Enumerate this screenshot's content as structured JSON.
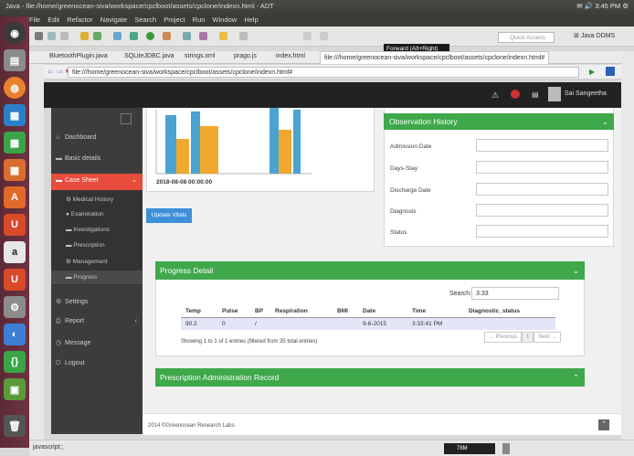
{
  "window": {
    "title": "Java - file:/home/greenocean-siva/workspace/cpclboot/assets/cpclone/indexn.html - ADT",
    "tray_time": "3:45 PM",
    "menu": [
      "File",
      "Edit",
      "Refactor",
      "Navigate",
      "Search",
      "Project",
      "Run",
      "Window",
      "Help"
    ]
  },
  "toolbar": {
    "quick_access_placeholder": "Quick Access",
    "perspective_java": "Java",
    "perspective_ddms": "DDMS",
    "tooltip": "Forward (Alt+Right)"
  },
  "editor_tabs": [
    "BluetoothPlugin.java",
    "SQLiteJDBC.java",
    "strings.xml",
    "prago.js",
    "index.html",
    "file:///home/greenocean-siva/workspace/cpclboot/assets/cpclone/indexn.html#"
  ],
  "browser": {
    "url": "file:///home/greenocean-siva/workspace/cpclboot/assets/cpclone/indexn.html#"
  },
  "header": {
    "user_name": "Sai Sangeetha"
  },
  "sidebar": {
    "items": [
      {
        "icon": "home-icon",
        "label": "Dashboard"
      },
      {
        "icon": "folder-icon",
        "label": "Basic details"
      },
      {
        "icon": "folder-icon",
        "label": "Case Sheet"
      }
    ],
    "subitems": [
      {
        "icon": "cogs-icon",
        "label": "Medical History"
      },
      {
        "icon": "circle-icon",
        "label": "Examination"
      },
      {
        "icon": "folder-icon",
        "label": "Investigations"
      },
      {
        "icon": "folder-icon",
        "label": "Prescription"
      },
      {
        "icon": "cogs-icon",
        "label": "Management"
      },
      {
        "icon": "folder-icon",
        "label": "Progress"
      }
    ],
    "bottom_items": [
      {
        "icon": "gear-icon",
        "label": "Settings"
      },
      {
        "icon": "printer-icon",
        "label": "Report"
      },
      {
        "icon": "clock-icon",
        "label": "Message"
      },
      {
        "icon": "power-icon",
        "label": "Logout"
      }
    ]
  },
  "vitals": {
    "chart_date": "2018-08-08 00:00:00",
    "update_button": "Update Vitals"
  },
  "observation": {
    "title": "Observation History",
    "fields": [
      "Admission Date",
      "Days-Stay",
      "Discharge Date",
      "Diagnosis",
      "Status"
    ]
  },
  "progress": {
    "title": "Progress Detail",
    "search_label": "Search:",
    "search_value": "3:33",
    "columns": [
      "Temp",
      "Pulse",
      "BP",
      "Respiration",
      "BMI",
      "Date",
      "Time",
      "Diagnostic_status"
    ],
    "rows": [
      [
        "90.2",
        "0",
        "/",
        "",
        "",
        "9-6-2015",
        "3:33:41 PM",
        ""
      ]
    ],
    "info": "Showing 1 to 1 of 1 entries (filtered from 35 total entries)",
    "pager": {
      "previous": "← Previous",
      "page": "1",
      "next": "Next →"
    }
  },
  "prescription": {
    "title": "Prescription Administration Record"
  },
  "footer": {
    "text": "2014 ©Greenocean Research Labs."
  },
  "status_bar": {
    "left": "javascript:;",
    "memory": "78M"
  },
  "colors": {
    "green": "#3ea84b",
    "active_nav": "#e74c3c",
    "button_blue": "#3d8fd8",
    "bar_blue": "#4aa3d0",
    "bar_orange": "#f0a830"
  }
}
